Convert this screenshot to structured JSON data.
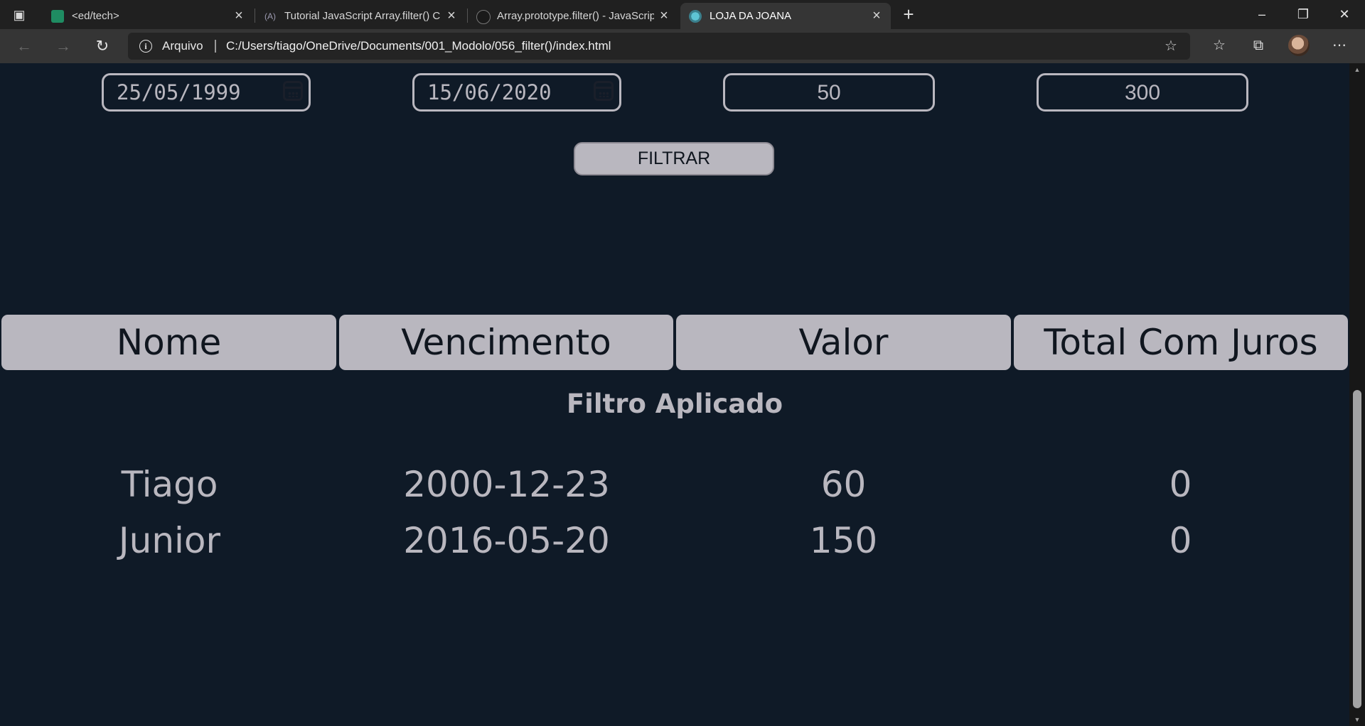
{
  "browser": {
    "tabs": [
      {
        "title": "<ed/tech>",
        "active": false
      },
      {
        "title": "Tutorial JavaScript Array.filter() C",
        "active": false
      },
      {
        "title": "Array.prototype.filter() - JavaScrip",
        "active": false
      },
      {
        "title": "LOJA DA JOANA",
        "active": true
      }
    ],
    "address_label": "Arquivo",
    "url": "C:/Users/tiago/OneDrive/Documents/001_Modolo/056_filter()/index.html"
  },
  "filters": {
    "date_from": "25/05/1999",
    "date_to": "15/06/2020",
    "value_min": "50",
    "value_max": "300",
    "button_label": "FILTRAR"
  },
  "table": {
    "headers": [
      "Nome",
      "Vencimento",
      "Valor",
      "Total Com Juros"
    ],
    "caption": "Filtro Aplicado",
    "rows": [
      [
        "Tiago",
        "2000-12-23",
        "60",
        "0"
      ],
      [
        "Junior",
        "2016-05-20",
        "150",
        "0"
      ]
    ]
  },
  "colors": {
    "page_background": "#0f1a27",
    "accent": "#b9b7bf"
  }
}
